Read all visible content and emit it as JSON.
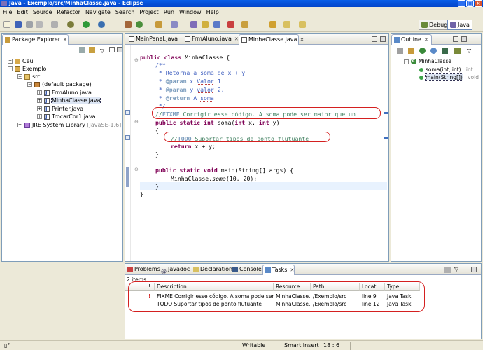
{
  "window": {
    "title": "Java - Exemplo/src/MinhaClasse.java - Eclipse",
    "controls": {
      "minimize": "_",
      "maximize": "□",
      "close": "×"
    }
  },
  "menu": [
    "File",
    "Edit",
    "Source",
    "Refactor",
    "Navigate",
    "Search",
    "Project",
    "Run",
    "Window",
    "Help"
  ],
  "perspectives": {
    "debug": "Debug",
    "java": "Java"
  },
  "package_explorer": {
    "title": "Package Explorer",
    "tree": [
      {
        "label": "Ceu",
        "type": "project",
        "expander": "+"
      },
      {
        "label": "Exemplo",
        "type": "project",
        "expander": "−"
      },
      {
        "label": "src",
        "type": "source-folder",
        "expander": "−"
      },
      {
        "label": "(default package)",
        "type": "package",
        "expander": "−"
      },
      {
        "label": "FrmAluno.java",
        "type": "java",
        "expander": "+"
      },
      {
        "label": "MinhaClasse.java",
        "type": "java",
        "expander": "+"
      },
      {
        "label": "Printer.java",
        "type": "java",
        "expander": "+"
      },
      {
        "label": "TrocarCor1.java",
        "type": "java",
        "expander": "+"
      },
      {
        "label": "JRE System Library",
        "suffix": "[JavaSE-1.6]",
        "type": "library",
        "expander": "+"
      }
    ]
  },
  "editor": {
    "tabs": [
      {
        "label": "MainPanel.java"
      },
      {
        "label": "FrmAluno.java"
      },
      {
        "label": "MinhaClasse.java"
      }
    ],
    "code": {
      "l1_kw1": "public",
      "l1_kw2": "class",
      "l1_rest": " MinhaClasse {",
      "l2": "/**",
      "l3_a": " * ",
      "l3_b": "Retorna",
      "l3_c": " a ",
      "l3_d": "soma",
      "l3_e": " de x + y",
      "l4_tag": "@param",
      "l4_rest": " x ",
      "l4_w": "Valor",
      "l4_n": " 1",
      "l5_tag": "@param",
      "l5_rest": " y ",
      "l5_w": "valor",
      "l5_n": " 2.",
      "l6_tag": "@return",
      "l6_rest": " A ",
      "l6_w": "soma",
      "l7": " */",
      "l8_tag": "FIXME",
      "l8_rest": " Corrigir esse código. A soma pode ser maior que un",
      "l9_kw1": "public",
      "l9_kw2": "static",
      "l9_kw3": "int",
      "l9_a": " soma(",
      "l9_kw4": "int",
      "l9_b": " x, ",
      "l9_kw5": "int",
      "l9_c": " y)",
      "l10": "{",
      "l11_tag": "TODO",
      "l11_rest": " Suportar tipos de ponto flutuante",
      "l12_kw": "return",
      "l12_rest": " x + y;",
      "l13": "}",
      "l14_kw1": "public",
      "l14_kw2": "static",
      "l14_kw3": "void",
      "l14_rest": " main(String[] args) {",
      "l15_a": "MinhaClasse.",
      "l15_b": "soma",
      "l15_c": "(10, 20);",
      "l16": "}",
      "l17": "}"
    }
  },
  "outline": {
    "title": "Outline",
    "items": [
      {
        "label": "MinhaClasse"
      },
      {
        "label": "soma(int, int)",
        "type": " : int"
      },
      {
        "label": "main(String[])",
        "type": " : void"
      }
    ]
  },
  "bottom": {
    "tabs": [
      "Problems",
      "Javadoc",
      "Declaration",
      "Console",
      "Tasks"
    ],
    "count": "2 items",
    "columns": [
      "!",
      "Description",
      "Resource",
      "Path",
      "Locat...",
      "Type"
    ],
    "rows": [
      {
        "description": "FIXME Corrigir esse código. A soma pode ser mai...",
        "resource": "MinhaClasse....",
        "path": "/Exemplo/src",
        "location": "line 9",
        "type": "Java Task",
        "priority": "!"
      },
      {
        "description": "TODO Suportar tipos de ponto flutuante",
        "resource": "MinhaClasse....",
        "path": "/Exemplo/src",
        "location": "line 12",
        "type": "Java Task",
        "priority": ""
      }
    ]
  },
  "status": {
    "writable": "Writable",
    "insert": "Smart Insert",
    "position": "18 : 6"
  },
  "colors": {
    "keyword": "#7f0055",
    "comment": "#3f5fbf",
    "task_tag": "#7f9fbf",
    "annotation": "#d42020"
  }
}
